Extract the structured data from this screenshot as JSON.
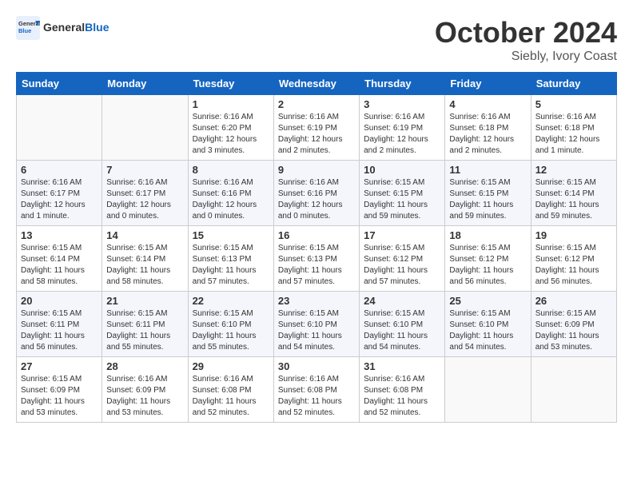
{
  "header": {
    "logo_general": "General",
    "logo_blue": "Blue",
    "month": "October 2024",
    "location": "Siebly, Ivory Coast"
  },
  "weekdays": [
    "Sunday",
    "Monday",
    "Tuesday",
    "Wednesday",
    "Thursday",
    "Friday",
    "Saturday"
  ],
  "weeks": [
    [
      {
        "day": "",
        "info": ""
      },
      {
        "day": "",
        "info": ""
      },
      {
        "day": "1",
        "info": "Sunrise: 6:16 AM\nSunset: 6:20 PM\nDaylight: 12 hours\nand 3 minutes."
      },
      {
        "day": "2",
        "info": "Sunrise: 6:16 AM\nSunset: 6:19 PM\nDaylight: 12 hours\nand 2 minutes."
      },
      {
        "day": "3",
        "info": "Sunrise: 6:16 AM\nSunset: 6:19 PM\nDaylight: 12 hours\nand 2 minutes."
      },
      {
        "day": "4",
        "info": "Sunrise: 6:16 AM\nSunset: 6:18 PM\nDaylight: 12 hours\nand 2 minutes."
      },
      {
        "day": "5",
        "info": "Sunrise: 6:16 AM\nSunset: 6:18 PM\nDaylight: 12 hours\nand 1 minute."
      }
    ],
    [
      {
        "day": "6",
        "info": "Sunrise: 6:16 AM\nSunset: 6:17 PM\nDaylight: 12 hours\nand 1 minute."
      },
      {
        "day": "7",
        "info": "Sunrise: 6:16 AM\nSunset: 6:17 PM\nDaylight: 12 hours\nand 0 minutes."
      },
      {
        "day": "8",
        "info": "Sunrise: 6:16 AM\nSunset: 6:16 PM\nDaylight: 12 hours\nand 0 minutes."
      },
      {
        "day": "9",
        "info": "Sunrise: 6:16 AM\nSunset: 6:16 PM\nDaylight: 12 hours\nand 0 minutes."
      },
      {
        "day": "10",
        "info": "Sunrise: 6:15 AM\nSunset: 6:15 PM\nDaylight: 11 hours\nand 59 minutes."
      },
      {
        "day": "11",
        "info": "Sunrise: 6:15 AM\nSunset: 6:15 PM\nDaylight: 11 hours\nand 59 minutes."
      },
      {
        "day": "12",
        "info": "Sunrise: 6:15 AM\nSunset: 6:14 PM\nDaylight: 11 hours\nand 59 minutes."
      }
    ],
    [
      {
        "day": "13",
        "info": "Sunrise: 6:15 AM\nSunset: 6:14 PM\nDaylight: 11 hours\nand 58 minutes."
      },
      {
        "day": "14",
        "info": "Sunrise: 6:15 AM\nSunset: 6:14 PM\nDaylight: 11 hours\nand 58 minutes."
      },
      {
        "day": "15",
        "info": "Sunrise: 6:15 AM\nSunset: 6:13 PM\nDaylight: 11 hours\nand 57 minutes."
      },
      {
        "day": "16",
        "info": "Sunrise: 6:15 AM\nSunset: 6:13 PM\nDaylight: 11 hours\nand 57 minutes."
      },
      {
        "day": "17",
        "info": "Sunrise: 6:15 AM\nSunset: 6:12 PM\nDaylight: 11 hours\nand 57 minutes."
      },
      {
        "day": "18",
        "info": "Sunrise: 6:15 AM\nSunset: 6:12 PM\nDaylight: 11 hours\nand 56 minutes."
      },
      {
        "day": "19",
        "info": "Sunrise: 6:15 AM\nSunset: 6:12 PM\nDaylight: 11 hours\nand 56 minutes."
      }
    ],
    [
      {
        "day": "20",
        "info": "Sunrise: 6:15 AM\nSunset: 6:11 PM\nDaylight: 11 hours\nand 56 minutes."
      },
      {
        "day": "21",
        "info": "Sunrise: 6:15 AM\nSunset: 6:11 PM\nDaylight: 11 hours\nand 55 minutes."
      },
      {
        "day": "22",
        "info": "Sunrise: 6:15 AM\nSunset: 6:10 PM\nDaylight: 11 hours\nand 55 minutes."
      },
      {
        "day": "23",
        "info": "Sunrise: 6:15 AM\nSunset: 6:10 PM\nDaylight: 11 hours\nand 54 minutes."
      },
      {
        "day": "24",
        "info": "Sunrise: 6:15 AM\nSunset: 6:10 PM\nDaylight: 11 hours\nand 54 minutes."
      },
      {
        "day": "25",
        "info": "Sunrise: 6:15 AM\nSunset: 6:10 PM\nDaylight: 11 hours\nand 54 minutes."
      },
      {
        "day": "26",
        "info": "Sunrise: 6:15 AM\nSunset: 6:09 PM\nDaylight: 11 hours\nand 53 minutes."
      }
    ],
    [
      {
        "day": "27",
        "info": "Sunrise: 6:15 AM\nSunset: 6:09 PM\nDaylight: 11 hours\nand 53 minutes."
      },
      {
        "day": "28",
        "info": "Sunrise: 6:16 AM\nSunset: 6:09 PM\nDaylight: 11 hours\nand 53 minutes."
      },
      {
        "day": "29",
        "info": "Sunrise: 6:16 AM\nSunset: 6:08 PM\nDaylight: 11 hours\nand 52 minutes."
      },
      {
        "day": "30",
        "info": "Sunrise: 6:16 AM\nSunset: 6:08 PM\nDaylight: 11 hours\nand 52 minutes."
      },
      {
        "day": "31",
        "info": "Sunrise: 6:16 AM\nSunset: 6:08 PM\nDaylight: 11 hours\nand 52 minutes."
      },
      {
        "day": "",
        "info": ""
      },
      {
        "day": "",
        "info": ""
      }
    ]
  ]
}
